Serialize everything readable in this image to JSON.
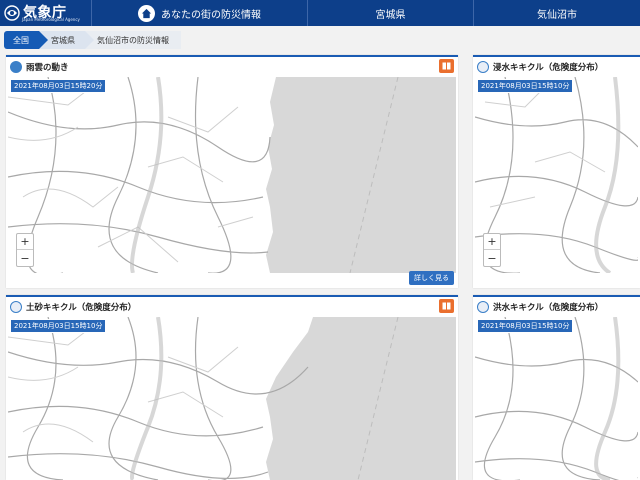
{
  "header": {
    "logo_text": "気象庁",
    "logo_sub": "Japan Meteorological Agency",
    "nav": [
      "あなたの街の防災情報",
      "宮城県",
      "気仙沼市"
    ]
  },
  "breadcrumb": [
    "全国",
    "宮城県",
    "気仙沼市の防災情報"
  ],
  "panels": [
    {
      "title": "雨雲の動き",
      "timestamp": "2021年08月03日15時20分",
      "more": "詳しく見る"
    },
    {
      "title": "浸水キキクル（危険度分布）",
      "timestamp": "2021年08月03日15時10分"
    },
    {
      "title": "土砂キキクル（危険度分布）",
      "timestamp": "2021年08月03日15時10分"
    },
    {
      "title": "洪水キキクル（危険度分布）",
      "timestamp": "2021年08月03日15時10分"
    }
  ],
  "zoom": {
    "in": "+",
    "out": "−"
  },
  "colors": {
    "header": "#0d3f8a",
    "accent": "#1a5bb3",
    "sea": "#d8d8d8",
    "book": "#ea6f2e"
  }
}
